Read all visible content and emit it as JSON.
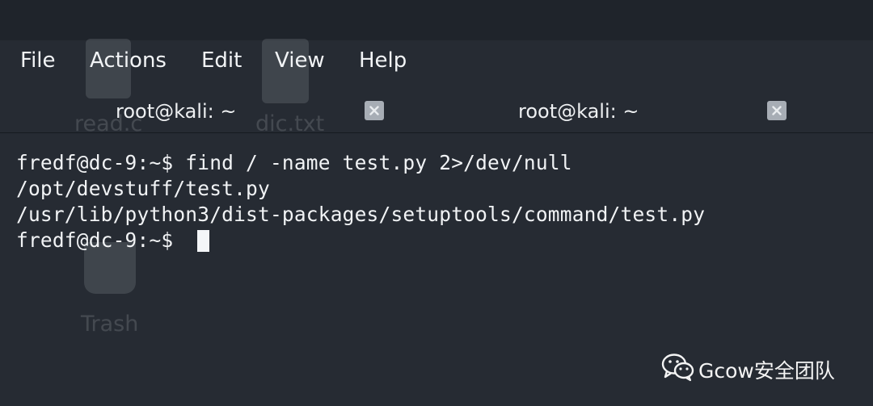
{
  "menu": {
    "file": "File",
    "actions": "Actions",
    "edit": "Edit",
    "view": "View",
    "help": "Help"
  },
  "tabs": [
    {
      "title": "root@kali: ~",
      "close_icon": "close-icon"
    },
    {
      "title": "root@kali: ~",
      "close_icon": "close-icon"
    }
  ],
  "desktop": {
    "icons": [
      {
        "label": "read.c",
        "icon": "c-file-icon"
      },
      {
        "label": "dic.txt",
        "icon": "text-file-icon"
      },
      {
        "label": "Trash",
        "icon": "trash-icon"
      }
    ]
  },
  "terminal": {
    "lines": [
      "fredf@dc-9:~$ find / -name test.py 2>/dev/null",
      "/opt/devstuff/test.py",
      "/usr/lib/python3/dist-packages/setuptools/command/test.py",
      "fredf@dc-9:~$ "
    ]
  },
  "watermark": {
    "text": "Gcow安全团队",
    "icon": "wechat-icon"
  },
  "colors": {
    "background": "#262b33",
    "text": "#f1f3f5",
    "close_button": "#a7adb5"
  }
}
